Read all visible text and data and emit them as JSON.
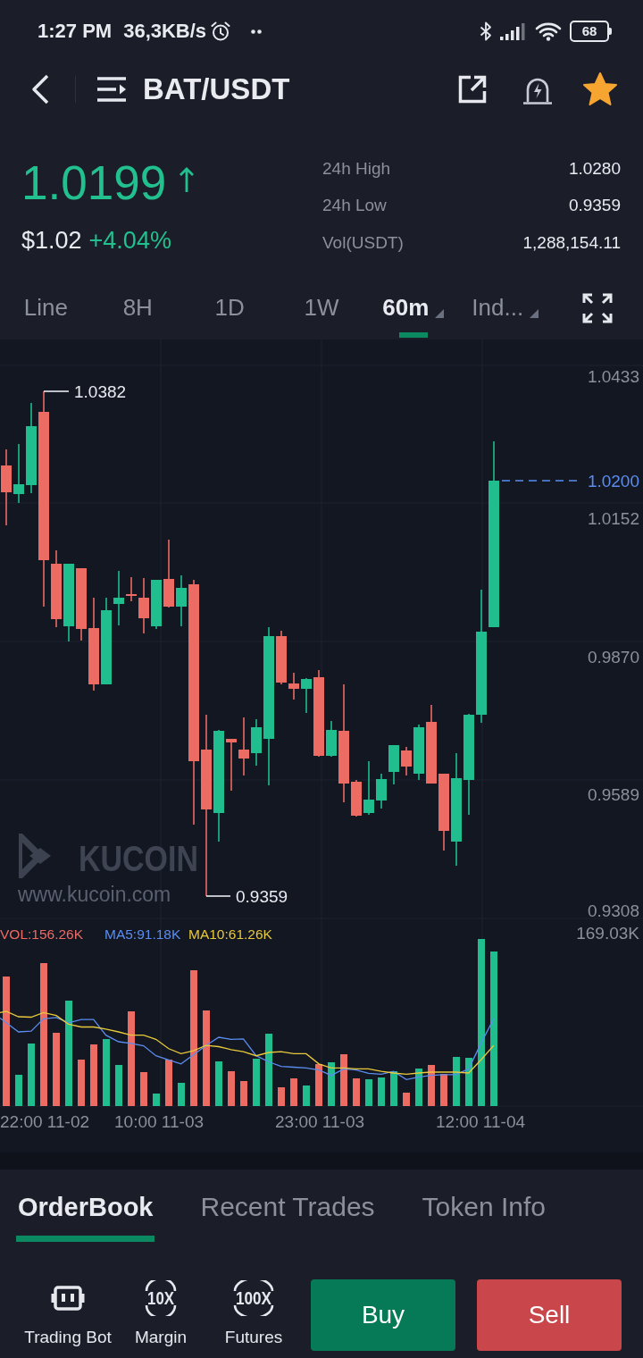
{
  "status_bar": {
    "time": "1:27 PM",
    "speed": "36,3KB/s",
    "battery": "68"
  },
  "header": {
    "title": "BAT/USDT",
    "favorited": true
  },
  "ticker": {
    "price": "1.0199",
    "fiat_price": "$1.02",
    "change": "+4.04%",
    "stats": [
      {
        "label": "24h High",
        "value": "1.0280"
      },
      {
        "label": "24h Low",
        "value": "0.9359"
      },
      {
        "label": "Vol(USDT)",
        "value": "1,288,154.11"
      }
    ]
  },
  "intervals": [
    {
      "label": "Line",
      "selected": false,
      "dropdown": false
    },
    {
      "label": "8H",
      "selected": false,
      "dropdown": false
    },
    {
      "label": "1D",
      "selected": false,
      "dropdown": false
    },
    {
      "label": "1W",
      "selected": false,
      "dropdown": false
    },
    {
      "label": "60m",
      "selected": true,
      "dropdown": true
    },
    {
      "label": "Ind...",
      "selected": false,
      "dropdown": true
    }
  ],
  "chart": {
    "price_axis": [
      "1.0433",
      "1.0152",
      "0.9870",
      "0.9589",
      "0.9308"
    ],
    "last_price": "1.0200",
    "high_label": "1.0382",
    "low_label": "0.9359",
    "watermark": {
      "brand": "KUCOIN",
      "url": "www.kucoin.com"
    },
    "volume_legend": [
      {
        "label": "VOL:156.26K",
        "color": "#ec6b63"
      },
      {
        "label": "MA5:91.18K",
        "color": "#5b8def"
      },
      {
        "label": "MA10:61.26K",
        "color": "#e8c93c"
      }
    ],
    "volume_axis": "169.03K",
    "time_axis": [
      "22:00 11-02",
      "10:00 11-03",
      "23:00 11-03",
      "12:00 11-04"
    ]
  },
  "tabs": [
    {
      "label": "OrderBook",
      "selected": true
    },
    {
      "label": "Recent Trades",
      "selected": false
    },
    {
      "label": "Token Info",
      "selected": false
    }
  ],
  "shortcuts": [
    {
      "label": "Trading Bot",
      "kind": "bot"
    },
    {
      "label": "Margin",
      "kind": "leverage",
      "icon_text": "10X"
    },
    {
      "label": "Futures",
      "kind": "leverage",
      "icon_text": "100X"
    }
  ],
  "trade_buttons": [
    {
      "label": "Buy",
      "kind": "buy"
    },
    {
      "label": "Sell",
      "kind": "sell"
    }
  ]
}
